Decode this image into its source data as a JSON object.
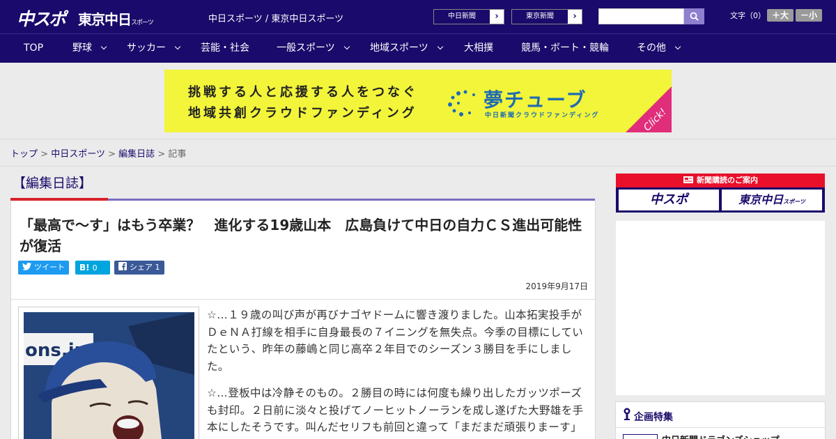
{
  "header": {
    "logo_main": "中スポ",
    "logo_sub": "東京中日",
    "logo_sub_small": "スポーツ",
    "site_links": "中日スポーツ / 東京中日スポーツ",
    "paper_buttons": [
      {
        "label": "中日新聞",
        "arrow": "›"
      },
      {
        "label": "東京新聞",
        "arrow": "›"
      }
    ],
    "search": {
      "value": "",
      "placeholder": ""
    },
    "font_size": {
      "label": "文字（0）",
      "bigger": "＋大",
      "smaller": "－小"
    }
  },
  "nav": {
    "items": [
      {
        "label": "TOP",
        "dropdown": false
      },
      {
        "label": "野球",
        "dropdown": true
      },
      {
        "label": "サッカー",
        "dropdown": true
      },
      {
        "label": "芸能・社会",
        "dropdown": false
      },
      {
        "label": "一般スポーツ",
        "dropdown": true
      },
      {
        "label": "地域スポーツ",
        "dropdown": true
      },
      {
        "label": "大相撲",
        "dropdown": false
      },
      {
        "label": "競馬・ボート・競輪",
        "dropdown": false
      },
      {
        "label": "その他",
        "dropdown": true
      }
    ]
  },
  "banner": {
    "line1": "挑戦する人と応援する人をつなぐ",
    "line2": "地域共創クラウドファンディング",
    "brand": "夢チューブ",
    "brand_sub": "中日新聞クラウドファンディング",
    "cta": "Click!",
    "colors": {
      "background": "#f2f53a",
      "brand": "#1f6bb3",
      "cta": "#e02e7a"
    }
  },
  "breadcrumb": {
    "items": [
      "トップ",
      "中日スポーツ",
      "編集日誌"
    ],
    "current": "記事",
    "separator": ">"
  },
  "section": {
    "title": "【編集日誌】"
  },
  "article": {
    "headline": "「最高で～す」はもう卒業？　進化する19歳山本　広島負けて中日の自力ＣＳ進出可能性が復活",
    "share": [
      {
        "icon": "twitter-icon",
        "label": "ツイート",
        "count": ""
      },
      {
        "icon": "hatena-icon",
        "label": "B!",
        "count": "0"
      },
      {
        "icon": "facebook-icon",
        "label": "シェア",
        "count": "1"
      }
    ],
    "date": "2019年9月17日",
    "paragraphs": [
      "☆…１９歳の叫び声が再びナゴヤドームに響き渡りました。山本拓実投手がＤｅＮＡ打線を相手に自身最長の７イニングを無失点。今季の目標にしていたという、昨年の藤嶋と同じ高卒２年目でのシーズン３勝目を手にしました。",
      "☆…登板中は冷静そのもの。２勝目の時には何度も繰り出したガッツポーズも封印。２日前に淡々と投げてノーヒットノーランを成し遂げた大野雄を手本にしたそうです。叫んだセリフも前回と違って「まだまだ頑張りまーす」"
    ],
    "photo_text": "ons.jp"
  },
  "sidebar": {
    "subscribe_title": "新聞購読のご案内",
    "subscribe_logos": [
      "中スポ",
      "東京中日"
    ],
    "subscribe_logo_small": "スポーツ",
    "feature_title": "企画特集",
    "feature_item": "中日新聞ドラゴンズショップ"
  },
  "colors": {
    "brand_navy": "#1a0a6b",
    "accent_red": "#d9202b",
    "accent_purple": "#7b6bc0",
    "twitter": "#1d9bf0",
    "hatena": "#00a4de",
    "facebook": "#3b5998"
  }
}
